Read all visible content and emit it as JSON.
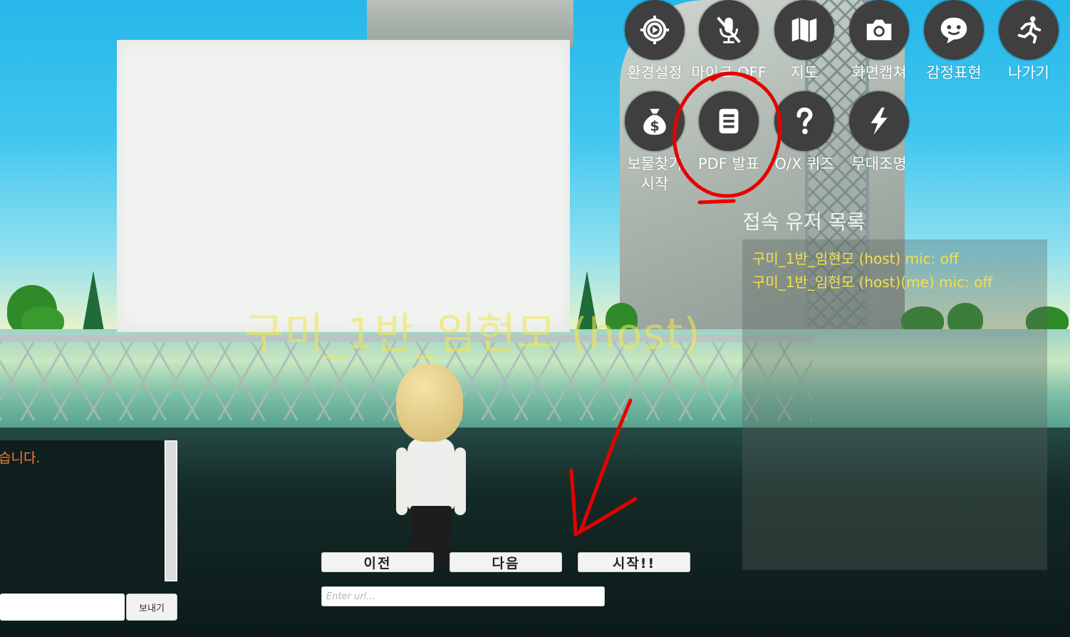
{
  "menu": {
    "row1": [
      {
        "label": "환경설정",
        "icon": "gear-play-icon"
      },
      {
        "label": "마이크 OFF",
        "icon": "mic-off-icon"
      },
      {
        "label": "지도",
        "icon": "map-icon"
      },
      {
        "label": "화면캡쳐",
        "icon": "camera-icon"
      },
      {
        "label": "감정표현",
        "icon": "emoji-icon"
      },
      {
        "label": "나가기",
        "icon": "exit-run-icon"
      }
    ],
    "row2": [
      {
        "label": "보물찾기\n시작",
        "icon": "money-bag-icon"
      },
      {
        "label": "PDF 발표",
        "icon": "document-icon"
      },
      {
        "label": "O/X 퀴즈",
        "icon": "question-icon"
      },
      {
        "label": "무대조명",
        "icon": "lightning-icon"
      }
    ]
  },
  "users": {
    "title": "접속 유저 목록",
    "list": [
      "구미_1반_임현모 (host) mic: off",
      "구미_1반_임현모 (host)(me) mic: off"
    ]
  },
  "player": {
    "name": "구미_1반_임현모 (host)"
  },
  "chat": {
    "message": "습니다.",
    "send_label": "보내기",
    "input_value": ""
  },
  "presentation": {
    "prev_label": "이전",
    "next_label": "다음",
    "start_label": "시작!!",
    "url_placeholder": "Enter url..."
  },
  "colors": {
    "user_text": "#f3e04a",
    "chat_text": "#ff7a2f",
    "annotation": "#e60000",
    "icon_bg": "#3f3f3f"
  }
}
